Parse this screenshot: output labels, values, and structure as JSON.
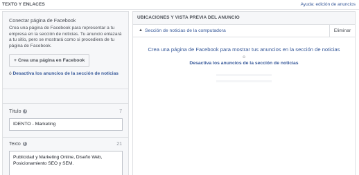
{
  "header": {
    "section_title": "TEXTO Y ENLACES",
    "help_link": "Ayuda: edición de anuncios"
  },
  "connect": {
    "title": "Conectar página de Facebook",
    "description": "Crea una página de Facebook para representar a tu empresa en la sección de noticias. Tu anuncio enlazará a tu sitio, pero se mostrará como si procediera de tu página de Facebook.",
    "create_button": "Crea una página en Facebook",
    "create_button_icon": "plus-icon",
    "or_prefix": "ó",
    "deactivate_link": "Desactiva los anuncios de la sección de noticias"
  },
  "title_field": {
    "label": "Título",
    "count": "7",
    "value": "IDENTO - Marketing"
  },
  "text_field": {
    "label": "Texto",
    "count": "21",
    "value": "Publicidad y Marketing Online, Diseño Web, Posicionamiento SEO y SEM."
  },
  "preview": {
    "header": "UBICACIONES Y VISTA PREVIA DEL ANUNCIO",
    "placement_label": "Sección de noticias de la computadora",
    "remove_button": "Eliminar",
    "message": "Crea una página de Facebook para mostrar tus anuncios en la sección de noticias",
    "or_text": "o",
    "deactivate_link": "Desactiva los anuncios de la sección de noticias"
  },
  "colors": {
    "link": "#365899",
    "border": "#dddfe2",
    "panel_bg": "#f6f7f9"
  }
}
